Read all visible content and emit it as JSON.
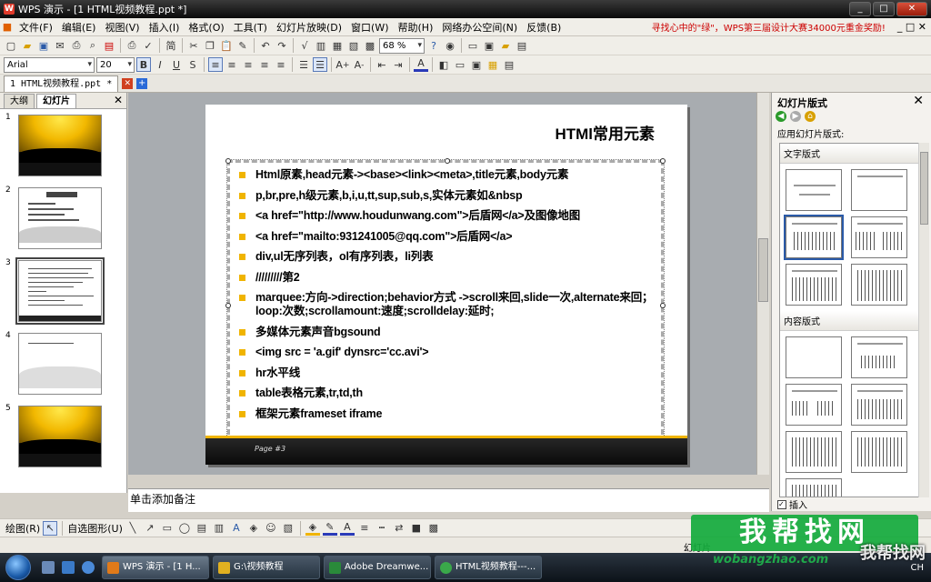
{
  "window": {
    "title": "WPS 演示 - [1 HTML视频教程.ppt *]"
  },
  "menu": {
    "items": [
      "文件(F)",
      "编辑(E)",
      "视图(V)",
      "插入(I)",
      "格式(O)",
      "工具(T)",
      "幻灯片放映(D)",
      "窗口(W)",
      "帮助(H)",
      "网络办公空间(N)",
      "反馈(B)"
    ],
    "promo": "寻找心中的\"绿\"，WPS第三届设计大赛34000元重金奖励!"
  },
  "toolbar": {
    "zoom": "68 %",
    "font": "Arial",
    "font_size": "20",
    "bold": "B",
    "italic": "I",
    "underline": "U",
    "strike": "S"
  },
  "doc_tab": {
    "label": "1 HTML视频教程.ppt *"
  },
  "left_panel": {
    "tabs": [
      "大纲",
      "幻灯片"
    ],
    "slides": [
      "1",
      "2",
      "3",
      "4",
      "5"
    ]
  },
  "slide": {
    "title": "HTMl常用元素",
    "page_label": "Page  #3",
    "bullets": [
      "Html原素,head元素-><base><link><meta>,title元素,body元素",
      "p,br,pre,h级元素,b,i,u,tt,sup,sub,s,实体元素如&nbsp",
      "<a href=\"http://www.houdunwang.com\">后盾网</a>及图像地图",
      "<a href=\"mailto:931241005@qq.com\">后盾网</a>",
      "div,ul无序列表，ol有序列表，li列表",
      "/////////第2",
      "marquee:方向->direction;behavior方式 ->scroll来回,slide一次,alternate来回；loop:次数;scrollamount:速度;scrolldelay:延时;",
      "多媒体元素声音bgsound",
      "<img src = 'a.gif' dynsrc='cc.avi'>",
      "hr水平线",
      "table表格元素,tr,td,th",
      "框架元素frameset  iframe"
    ]
  },
  "notes": {
    "placeholder": "单击添加备注"
  },
  "right_panel": {
    "title": "幻灯片版式",
    "apply_label": "应用幻灯片版式:",
    "group_text": "文字版式",
    "group_content": "内容版式",
    "insert_label": "插入"
  },
  "draw_toolbar": {
    "draw": "绘图(R)",
    "autoshape": "自选图形(U)"
  },
  "status": {
    "left": "幻灯片",
    "ime": "CH"
  },
  "taskbar": {
    "tasks": [
      "WPS 演示 - [1 H...",
      "G:\\视频教程",
      "Adobe Dreamwe...",
      "HTML视频教程---..."
    ]
  },
  "watermark": {
    "big": "我帮找网",
    "logo": "我帮找网",
    "url": "wobangzhao.com",
    "url2": "wobangzhao.com"
  },
  "colors": {
    "accent": "#f0b400",
    "promo": "#cc0000",
    "watermark": "#1fa84a"
  }
}
